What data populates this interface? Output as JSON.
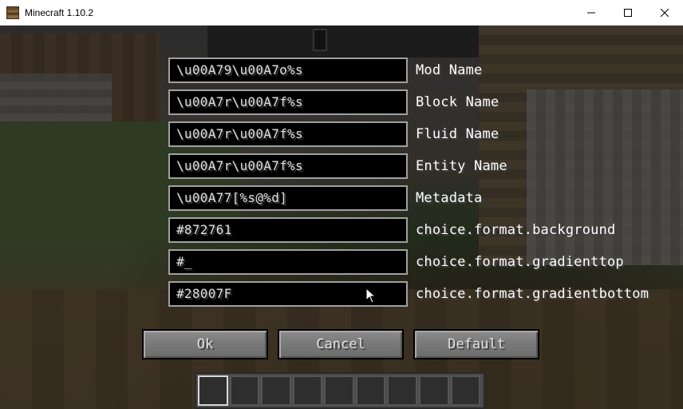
{
  "window": {
    "title": "Minecraft 1.10.2"
  },
  "config_rows": [
    {
      "value": "\\u00A79\\u00A7o%s",
      "label": "Mod Name"
    },
    {
      "value": "\\u00A7r\\u00A7f%s",
      "label": "Block Name"
    },
    {
      "value": "\\u00A7r\\u00A7f%s",
      "label": "Fluid Name"
    },
    {
      "value": "\\u00A7r\\u00A7f%s",
      "label": "Entity Name"
    },
    {
      "value": "\\u00A77[%s@%d]",
      "label": "Metadata"
    },
    {
      "value": "#872761",
      "label": "choice.format.background"
    },
    {
      "value": "#_",
      "label": "choice.format.gradienttop"
    },
    {
      "value": "#28007F",
      "label": "choice.format.gradientbottom"
    }
  ],
  "buttons": {
    "ok": "Ok",
    "cancel": "Cancel",
    "default": "Default"
  },
  "hotbar": {
    "slot_count": 9,
    "selected_slot": 1
  },
  "icons": {
    "app": "minecraft-block-icon",
    "minimize": "minimize-icon",
    "maximize": "maximize-icon",
    "close": "close-icon",
    "cursor": "mouse-pointer-icon"
  }
}
